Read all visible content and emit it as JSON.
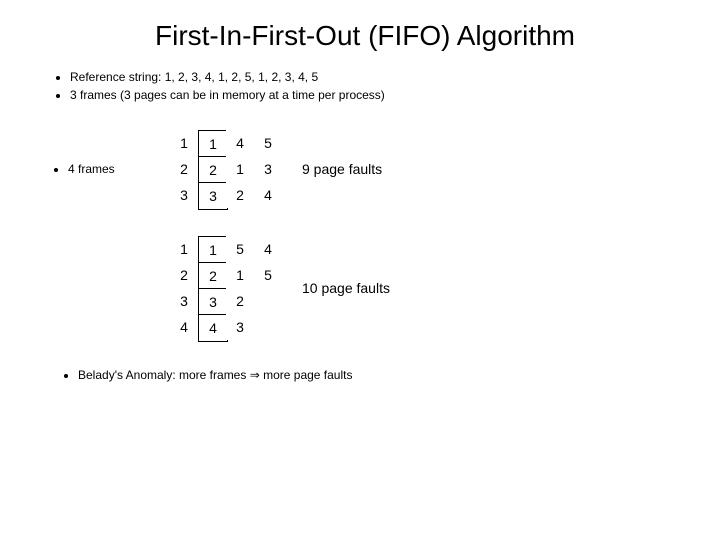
{
  "title": "First-In-First-Out (FIFO) Algorithm",
  "bullets": {
    "b1": "Reference string: 1, 2, 3, 4, 1, 2, 5, 1, 2, 3, 4, 5",
    "b2": "3 frames (3 pages can be in memory at a time per process)"
  },
  "label4frames": "4 frames",
  "table3": {
    "r0": {
      "c0": "1",
      "c1": "1",
      "c2": "4",
      "c3": "5"
    },
    "r1": {
      "c0": "2",
      "c1": "2",
      "c2": "1",
      "c3": "3"
    },
    "r2": {
      "c0": "3",
      "c1": "3",
      "c2": "2",
      "c3": "4"
    }
  },
  "faults3": "9 page faults",
  "table4": {
    "r0": {
      "c0": "1",
      "c1": "1",
      "c2": "5",
      "c3": "4"
    },
    "r1": {
      "c0": "2",
      "c1": "2",
      "c2": "1",
      "c3": "5"
    },
    "r2": {
      "c0": "3",
      "c1": "3",
      "c2": "2",
      "c3": ""
    },
    "r3": {
      "c0": "4",
      "c1": "4",
      "c2": "3",
      "c3": ""
    }
  },
  "faults4": "10 page faults",
  "anomaly": {
    "prefix": "Belady's Anomaly: more frames ",
    "arrow": "⇒",
    "suffix": " more page faults"
  }
}
